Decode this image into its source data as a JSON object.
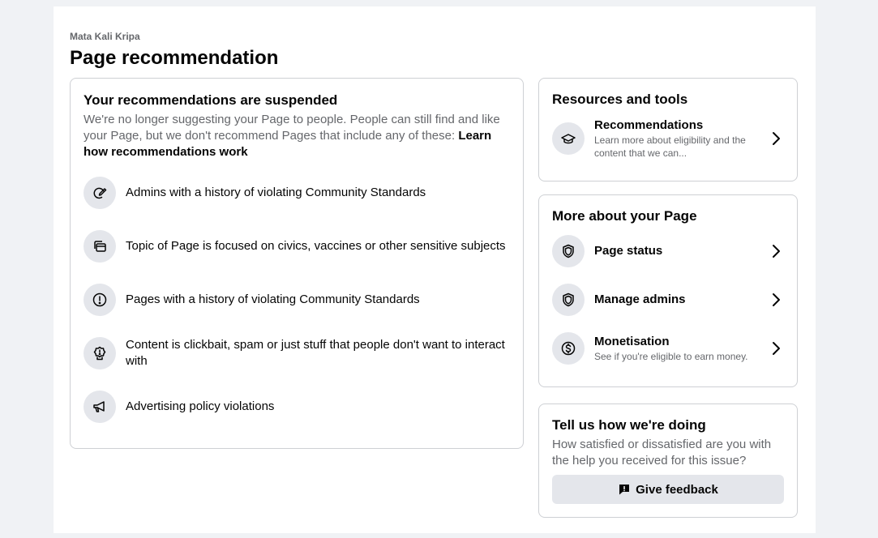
{
  "header": {
    "page_name": "Mata Kali Kripa",
    "title": "Page recommendation"
  },
  "suspended": {
    "title": "Your recommendations are suspended",
    "description": "We're no longer suggesting your Page to people. People can still find and like your Page, but we don't recommend Pages that include any of these: ",
    "learn_link": "Learn how recommendations work",
    "reasons": [
      {
        "icon": "edit-pen-icon",
        "text": "Admins with a history of violating Community Standards"
      },
      {
        "icon": "stacked-pages-icon",
        "text": "Topic of Page is focused on civics, vaccines or other sensitive subjects"
      },
      {
        "icon": "alert-circle-icon",
        "text": "Pages with a history of violating Community Standards"
      },
      {
        "icon": "badge-alert-icon",
        "text": "Content is clickbait, spam or just stuff that people don't want to interact with"
      },
      {
        "icon": "megaphone-icon",
        "text": "Advertising policy violations"
      }
    ]
  },
  "resources": {
    "title": "Resources and tools",
    "items": [
      {
        "icon": "graduation-cap-icon",
        "title": "Recommendations",
        "subtitle": "Learn more about eligibility and the content that we can..."
      }
    ]
  },
  "more_about": {
    "title": "More about your Page",
    "items": [
      {
        "icon": "shield-icon",
        "title": "Page status",
        "subtitle": ""
      },
      {
        "icon": "shield-icon",
        "title": "Manage admins",
        "subtitle": ""
      },
      {
        "icon": "dollar-circle-icon",
        "title": "Monetisation",
        "subtitle": "See if you're eligible to earn money."
      }
    ]
  },
  "feedback": {
    "title": "Tell us how we're doing",
    "description": "How satisfied or dissatisfied are you with the help you received for this issue?",
    "button_label": "Give feedback",
    "button_icon": "feedback-icon"
  }
}
